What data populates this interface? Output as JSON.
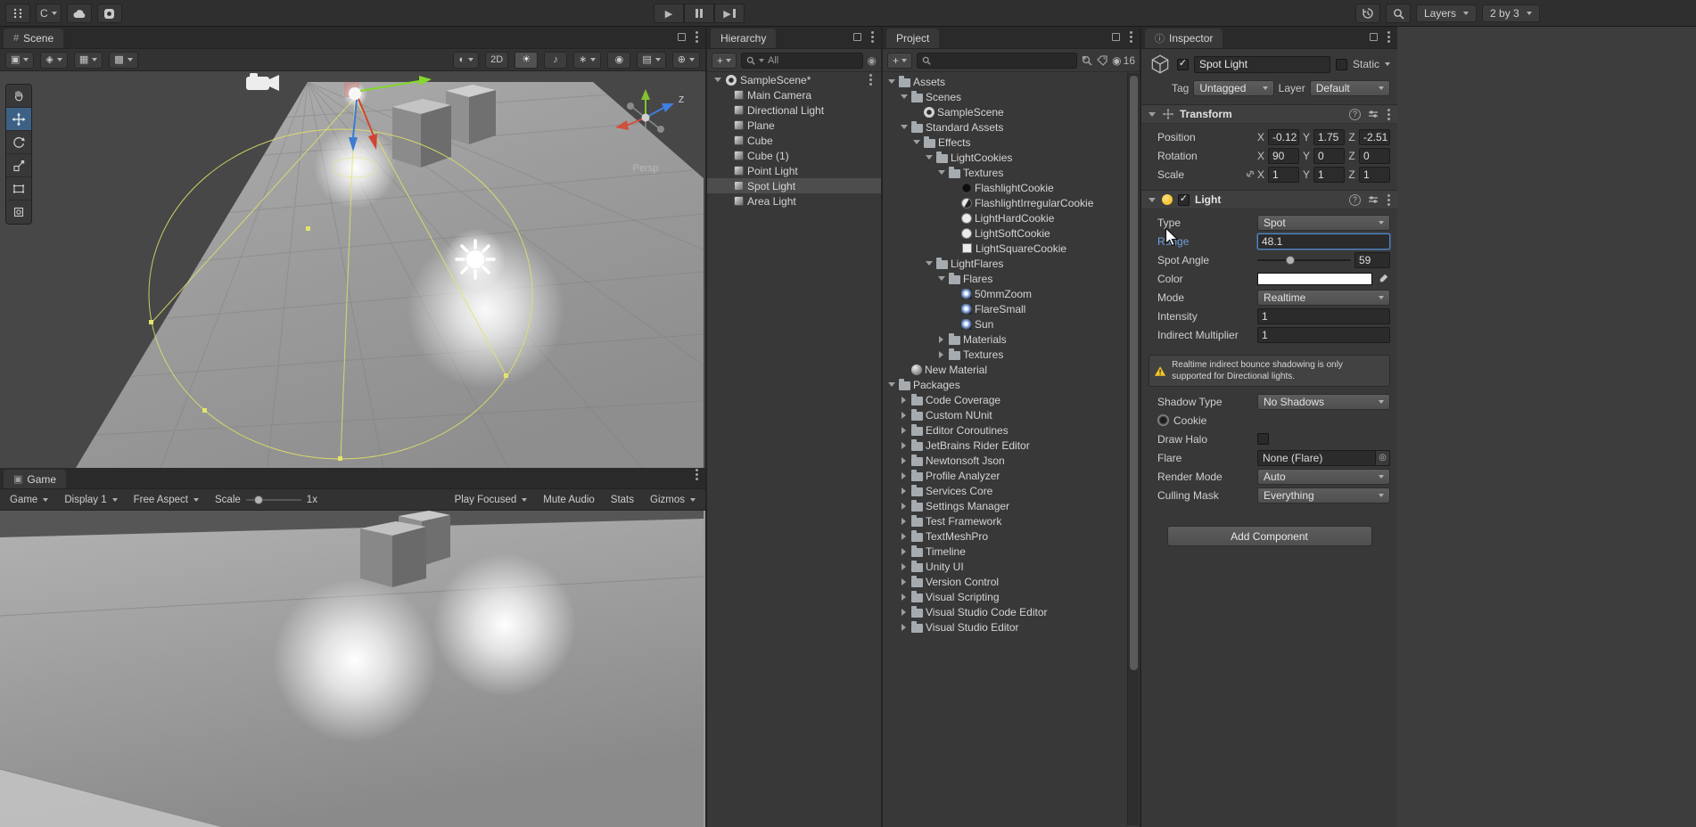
{
  "colors": {
    "selection": "#4d4d4d",
    "focus_blue": "#4e84c4",
    "active_label_blue": "#6f9eda",
    "warning_yellow": "#f5c528",
    "axis_x_red": "#d04434",
    "axis_y_green": "#84d82b",
    "axis_z_blue": "#3a7bd4",
    "light_cone_yellow": "#e3e36a"
  },
  "icons": {
    "scene_tab": "#",
    "game_tab": "▣",
    "inspector_tab": "ⓘ",
    "play": "▶",
    "step_play": "▶",
    "draw_mode": "◐",
    "lighting": "☀",
    "audio": "♪",
    "effects": "∗",
    "visibility": "◉",
    "camera": "▤",
    "gizmos_globe": "⊕",
    "pivot": "▣",
    "rotation": "◈",
    "grid_snap": "▦",
    "increment_snap": "▩",
    "plus": "+",
    "object_picker": "◎",
    "eye": "◉",
    "check": "✓"
  },
  "topbar": {
    "account": "C",
    "layers_label": "Layers",
    "layout_label": "2 by 3"
  },
  "scene_panel": {
    "tab_label": "Scene",
    "toolbar": {
      "two_d": "2D"
    },
    "persp_label": "Persp",
    "axis_z_label": "Z"
  },
  "game_panel": {
    "tab_label": "Game",
    "menu": "Game",
    "display": "Display 1",
    "aspect": "Free Aspect",
    "scale_label": "Scale",
    "scale_value": "1x",
    "focus": "Play Focused",
    "mute": "Mute Audio",
    "stats": "Stats",
    "gizmos": "Gizmos"
  },
  "hierarchy_panel": {
    "tab_label": "Hierarchy",
    "search_value": "All",
    "root_label": "SampleScene*",
    "items": [
      {
        "label": "Main Camera"
      },
      {
        "label": "Directional Light"
      },
      {
        "label": "Plane"
      },
      {
        "label": "Cube"
      },
      {
        "label": "Cube (1)"
      },
      {
        "label": "Point Light"
      },
      {
        "label": "Spot Light",
        "selected": true
      },
      {
        "label": "Area Light"
      }
    ]
  },
  "project_panel": {
    "tab_label": "Project",
    "hidden_count": "16",
    "tree": [
      {
        "label": "Assets",
        "level": 0,
        "icon": "folder",
        "expand": "open"
      },
      {
        "label": "Scenes",
        "level": 1,
        "icon": "folder",
        "expand": "open"
      },
      {
        "label": "SampleScene",
        "level": 2,
        "icon": "scene"
      },
      {
        "label": "Standard Assets",
        "level": 1,
        "icon": "folder",
        "expand": "open"
      },
      {
        "label": "Effects",
        "level": 2,
        "icon": "folder",
        "expand": "open"
      },
      {
        "label": "LightCookies",
        "level": 3,
        "icon": "folder",
        "expand": "open"
      },
      {
        "label": "Textures",
        "level": 4,
        "icon": "folder",
        "expand": "open"
      },
      {
        "label": "FlashlightCookie",
        "level": 5,
        "icon": "cookie-dark"
      },
      {
        "label": "FlashlightIrregularCookie",
        "level": 5,
        "icon": "cookie-half"
      },
      {
        "label": "LightHardCookie",
        "level": 5,
        "icon": "cookie-light"
      },
      {
        "label": "LightSoftCookie",
        "level": 5,
        "icon": "cookie-light"
      },
      {
        "label": "LightSquareCookie",
        "level": 5,
        "icon": "cookie-square"
      },
      {
        "label": "LightFlares",
        "level": 3,
        "icon": "folder",
        "expand": "open"
      },
      {
        "label": "Flares",
        "level": 4,
        "icon": "folder",
        "expand": "open"
      },
      {
        "label": "50mmZoom",
        "level": 5,
        "icon": "flare"
      },
      {
        "label": "FlareSmall",
        "level": 5,
        "icon": "flare"
      },
      {
        "label": "Sun",
        "level": 5,
        "icon": "flare"
      },
      {
        "label": "Materials",
        "level": 4,
        "icon": "folder",
        "expand": "closed"
      },
      {
        "label": "Textures",
        "level": 4,
        "icon": "folder",
        "expand": "closed"
      },
      {
        "label": "New Material",
        "level": 1,
        "icon": "material"
      },
      {
        "label": "Packages",
        "level": 0,
        "icon": "folder",
        "expand": "open"
      },
      {
        "label": "Code Coverage",
        "level": 1,
        "icon": "folder",
        "expand": "closed"
      },
      {
        "label": "Custom NUnit",
        "level": 1,
        "icon": "folder",
        "expand": "closed"
      },
      {
        "label": "Editor Coroutines",
        "level": 1,
        "icon": "folder",
        "expand": "closed"
      },
      {
        "label": "JetBrains Rider Editor",
        "level": 1,
        "icon": "folder",
        "expand": "closed"
      },
      {
        "label": "Newtonsoft Json",
        "level": 1,
        "icon": "folder",
        "expand": "closed"
      },
      {
        "label": "Profile Analyzer",
        "level": 1,
        "icon": "folder",
        "expand": "closed"
      },
      {
        "label": "Services Core",
        "level": 1,
        "icon": "folder",
        "expand": "closed"
      },
      {
        "label": "Settings Manager",
        "level": 1,
        "icon": "folder",
        "expand": "closed"
      },
      {
        "label": "Test Framework",
        "level": 1,
        "icon": "folder",
        "expand": "closed"
      },
      {
        "label": "TextMeshPro",
        "level": 1,
        "icon": "folder",
        "expand": "closed"
      },
      {
        "label": "Timeline",
        "level": 1,
        "icon": "folder",
        "expand": "closed"
      },
      {
        "label": "Unity UI",
        "level": 1,
        "icon": "folder",
        "expand": "closed"
      },
      {
        "label": "Version Control",
        "level": 1,
        "icon": "folder",
        "expand": "closed"
      },
      {
        "label": "Visual Scripting",
        "level": 1,
        "icon": "folder",
        "expand": "closed"
      },
      {
        "label": "Visual Studio Code Editor",
        "level": 1,
        "icon": "folder",
        "expand": "closed"
      },
      {
        "label": "Visual Studio Editor",
        "level": 1,
        "icon": "folder",
        "expand": "closed"
      }
    ]
  },
  "inspector_panel": {
    "tab_label": "Inspector",
    "name": "Spot Light",
    "static_label": "Static",
    "tag_label": "Tag",
    "tag_value": "Untagged",
    "layer_label": "Layer",
    "layer_value": "Default",
    "transform": {
      "title": "Transform",
      "x_label": "X",
      "y_label": "Y",
      "z_label": "Z",
      "rows": [
        {
          "label": "Position",
          "x": "-0.12",
          "y": "1.75",
          "z": "-2.51"
        },
        {
          "label": "Rotation",
          "x": "90",
          "y": "0",
          "z": "0"
        },
        {
          "label": "Scale",
          "x": "1",
          "y": "1",
          "z": "1",
          "link": true
        }
      ]
    },
    "light": {
      "title": "Light",
      "type_label": "Type",
      "type_value": "Spot",
      "range_label": "Range",
      "range_value": "48.1",
      "spot_angle_label": "Spot Angle",
      "spot_angle_value": "59",
      "color_label": "Color",
      "mode_label": "Mode",
      "mode_value": "Realtime",
      "intensity_label": "Intensity",
      "intensity_value": "1",
      "indirect_label": "Indirect Multiplier",
      "indirect_value": "1",
      "warning_text": "Realtime indirect bounce shadowing is only supported for Directional lights.",
      "shadow_type_label": "Shadow Type",
      "shadow_type_value": "No Shadows",
      "cookie_label": "Cookie",
      "draw_halo_label": "Draw Halo",
      "flare_label": "Flare",
      "flare_value": "None (Flare)",
      "render_mode_label": "Render Mode",
      "render_mode_value": "Auto",
      "culling_mask_label": "Culling Mask",
      "culling_mask_value": "Everything"
    },
    "add_component_label": "Add Component"
  }
}
